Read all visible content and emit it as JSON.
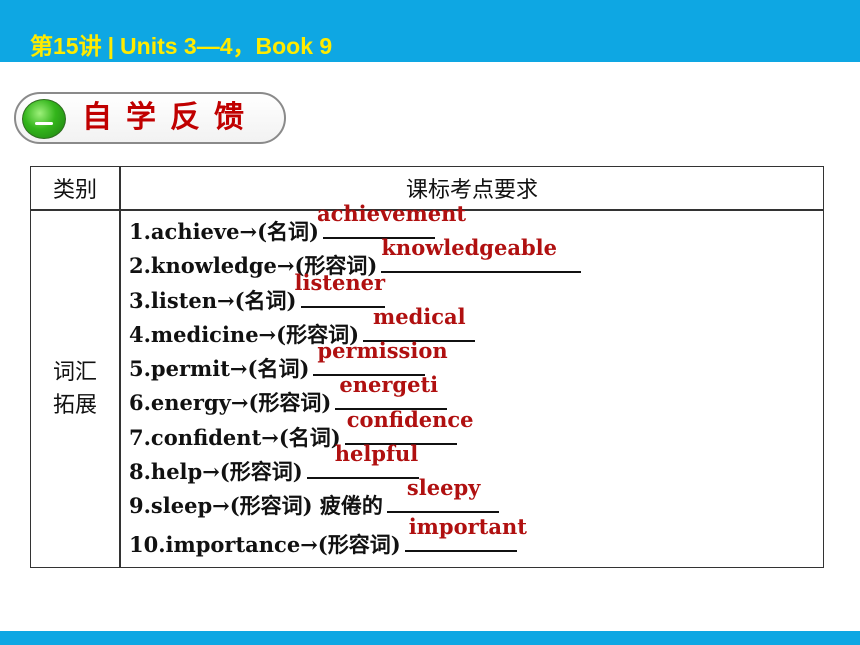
{
  "header": {
    "lecture": "第15讲",
    "separator": "|",
    "subtitle": "Units 3—4，Book 9"
  },
  "section": {
    "title": "自学反馈"
  },
  "table": {
    "col_category": "类别",
    "col_requirements": "课标考点要求",
    "category_line1": "词汇",
    "category_line2": "拓展",
    "items": [
      {
        "prompt": "1.achieve→(名词)",
        "answer": "achievement"
      },
      {
        "prompt": "2.knowledge→(形容词)",
        "answer": "knowledgeable"
      },
      {
        "prompt": "3.listen→(名词)",
        "answer": "listener"
      },
      {
        "prompt": "4.medicine→(形容词)",
        "answer": "medical"
      },
      {
        "prompt": "5.permit→(名词)",
        "answer": "permission"
      },
      {
        "prompt": "6.energy→(形容词)",
        "answer": "energeti"
      },
      {
        "prompt": "7.confident→(名词)",
        "answer": "confidence"
      },
      {
        "prompt": "8.help→(形容词)",
        "answer": "helpful"
      },
      {
        "prompt": "9.sleep→(形容词) 疲倦的",
        "answer": "sleepy"
      },
      {
        "prompt": "10.importance→(形容词)",
        "answer": "important"
      }
    ]
  },
  "colors": {
    "accent_bar": "#0ea7e3",
    "header_text": "#ffeb00",
    "answer_text": "#b01010",
    "section_title": "#c00000"
  }
}
